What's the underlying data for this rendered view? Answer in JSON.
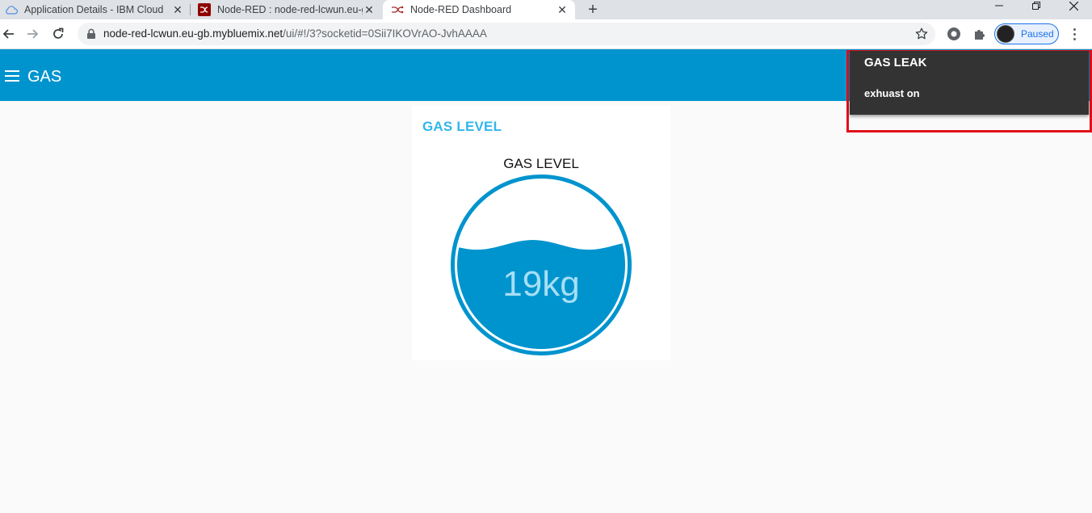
{
  "browser": {
    "tabs": [
      {
        "title": "Application Details - IBM Cloud",
        "icon": "cloud-icon",
        "active": false
      },
      {
        "title": "Node-RED : node-red-lcwun.eu-g",
        "icon": "node-red-icon",
        "active": false
      },
      {
        "title": "Node-RED Dashboard",
        "icon": "node-red-icon",
        "active": true
      }
    ],
    "url_host": "node-red-lcwun.eu-gb.mybluemix.net",
    "url_path": "/ui/#!/3?socketid=0Sii7IKOVrAO-JvhAAAA",
    "profile_label": "Paused"
  },
  "app": {
    "title": "GAS",
    "header_color": "#0094ce"
  },
  "card": {
    "group_title": "GAS LEVEL",
    "gauge": {
      "label": "GAS LEVEL",
      "value_text": "19kg",
      "level": 0.62,
      "color": "#0094ce"
    }
  },
  "toast": {
    "title": "GAS LEAK",
    "message": "exhuast on",
    "highlight_color": "#e0101a"
  }
}
